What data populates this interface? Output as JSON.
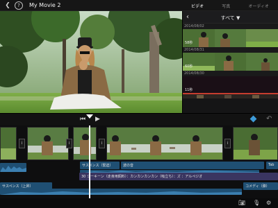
{
  "app": {
    "title": "My Movie 2"
  },
  "tabs": [
    {
      "label": "ビデオ",
      "active": true
    },
    {
      "label": "写真",
      "active": false
    },
    {
      "label": "オーディオ",
      "active": false
    }
  ],
  "media": {
    "filter_label": "すべて ▼",
    "sections": [
      {
        "date": "2014/08/02",
        "duration": "58秒"
      },
      {
        "date": "2014/08/31",
        "duration": "60秒"
      },
      {
        "date": "2014/08/30",
        "duration": "11秒"
      }
    ]
  },
  "timeline": {
    "audio": [
      {
        "label": "サスペンス（緊迫）"
      },
      {
        "label": "波の音"
      },
      {
        "label": "30 シーキーン（走身用飼料）：カンカンカンカン（吸立ち）：ズ ：アルペジオ"
      },
      {
        "label": "サスペンス（上昇）"
      },
      {
        "label": "コメディ（弾）"
      },
      {
        "label": "Tab"
      }
    ]
  },
  "colors": {
    "accent": "#3e9bd8",
    "audio_blue": "#1f4f73",
    "audio_purple": "#3a3560"
  }
}
